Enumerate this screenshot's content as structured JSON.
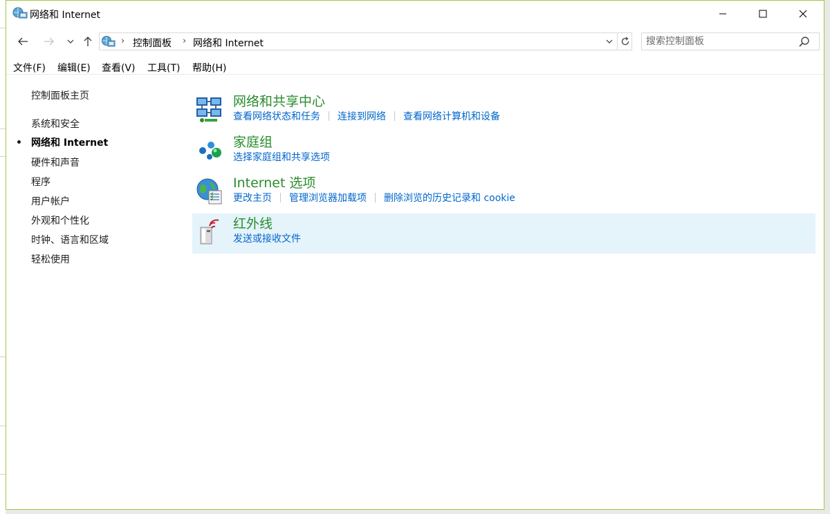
{
  "window": {
    "title": "网络和 Internet"
  },
  "window_controls": {
    "minimize": "minimize",
    "maximize": "maximize",
    "close": "close"
  },
  "address_bar": {
    "breadcrumbs": [
      "控制面板",
      "网络和 Internet"
    ]
  },
  "search": {
    "placeholder": "搜索控制面板"
  },
  "menu": [
    "文件(F)",
    "编辑(E)",
    "查看(V)",
    "工具(T)",
    "帮助(H)"
  ],
  "left_nav": {
    "home": "控制面板主页",
    "items": [
      "系统和安全",
      "网络和 Internet",
      "硬件和声音",
      "程序",
      "用户帐户",
      "外观和个性化",
      "时钟、语言和区域",
      "轻松使用"
    ],
    "active_index": 1
  },
  "categories": [
    {
      "title": "网络和共享中心",
      "icon": "network-sharing-center-icon",
      "links": [
        "查看网络状态和任务",
        "连接到网络",
        "查看网络计算机和设备"
      ]
    },
    {
      "title": "家庭组",
      "icon": "homegroup-icon",
      "links": [
        "选择家庭组和共享选项"
      ]
    },
    {
      "title": "Internet 选项",
      "icon": "internet-options-icon",
      "links": [
        "更改主页",
        "管理浏览器加载项",
        "删除浏览的历史记录和 cookie"
      ]
    },
    {
      "title": "红外线",
      "icon": "infrared-icon",
      "links": [
        "发送或接收文件"
      ],
      "highlighted": true
    }
  ],
  "colors": {
    "title_green": "#2a8c2d",
    "link_blue": "#0066cc",
    "hover_bg": "#e5f3fb",
    "window_border": "#9fc93f"
  }
}
